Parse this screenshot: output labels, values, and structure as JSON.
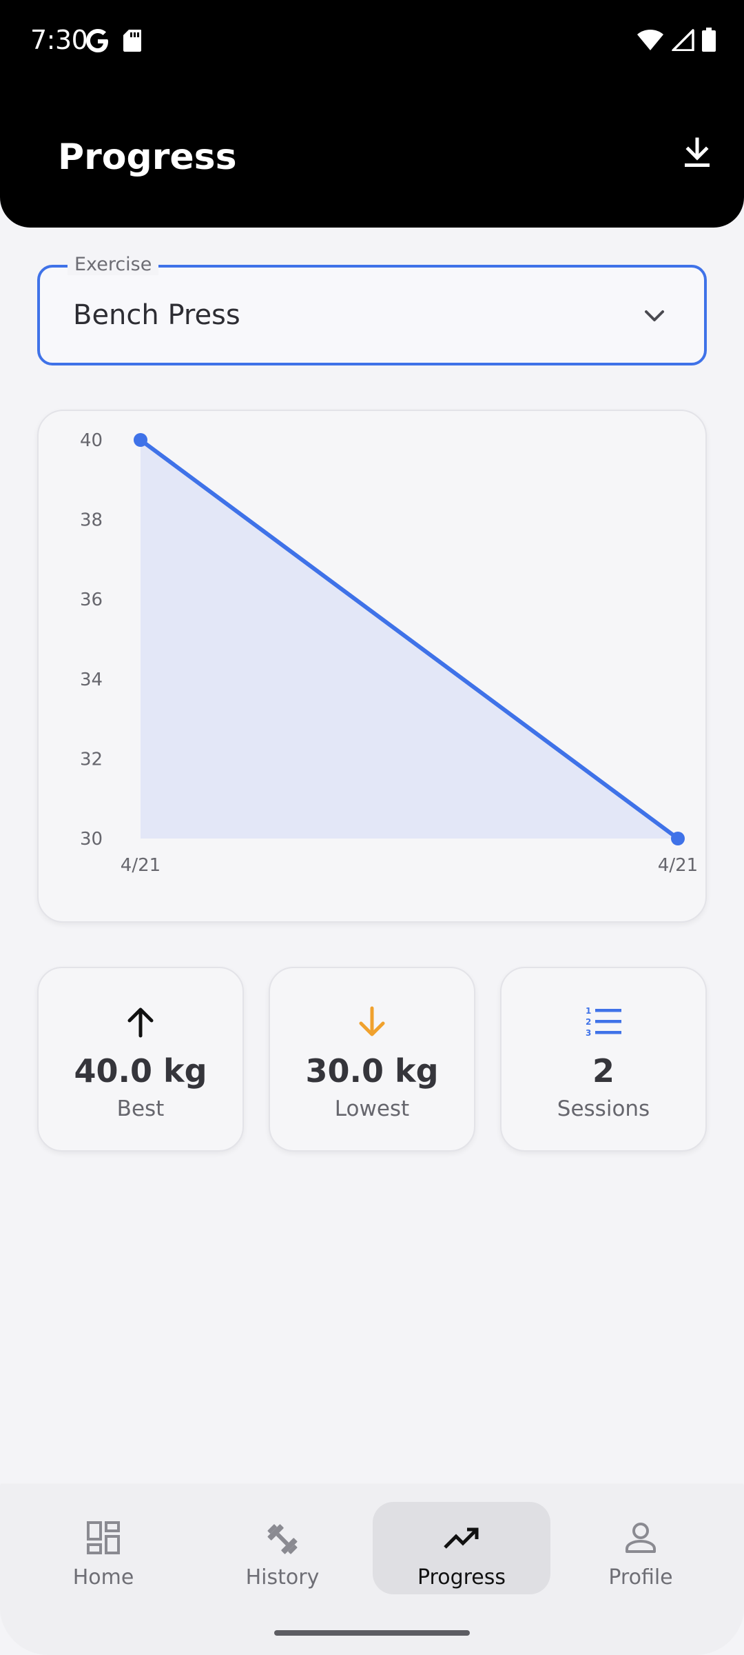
{
  "status_bar": {
    "time": "7:30",
    "left_icons": [
      "google-icon",
      "sd-card-icon"
    ],
    "right_icons": [
      "wifi-icon",
      "cell-signal-icon",
      "battery-icon"
    ]
  },
  "app_bar": {
    "title": "Progress",
    "action_icon": "download-icon"
  },
  "exercise_select": {
    "label": "Exercise",
    "value": "Bench Press"
  },
  "colors": {
    "accent": "#3f72e8",
    "area_fill": "#e3e7f7",
    "lowest": "#f0a12d",
    "app_bar": "#000000",
    "background": "#f4f4f7"
  },
  "chart_data": {
    "type": "line",
    "x": [
      "4/21",
      "4/21"
    ],
    "series": [
      {
        "values": [
          40,
          30
        ]
      }
    ],
    "y_ticks": [
      30,
      32,
      34,
      36,
      38,
      40
    ],
    "x_tick_labels": [
      "4/21",
      "4/21"
    ],
    "ylim": [
      30,
      40
    ],
    "area_fill": true,
    "grid": false
  },
  "stats": [
    {
      "icon": "arrow-up-icon",
      "value": "40.0 kg",
      "label": "Best"
    },
    {
      "icon": "arrow-down-icon",
      "value": "30.0 kg",
      "label": "Lowest"
    },
    {
      "icon": "numbered-list-icon",
      "value": "2",
      "label": "Sessions"
    }
  ],
  "bottom_nav": {
    "items": [
      {
        "label": "Home",
        "icon": "dashboard-icon",
        "active": false
      },
      {
        "label": "History",
        "icon": "dumbbell-icon",
        "active": false
      },
      {
        "label": "Progress",
        "icon": "trending-up-icon",
        "active": true
      },
      {
        "label": "Profile",
        "icon": "person-icon",
        "active": false
      }
    ]
  }
}
